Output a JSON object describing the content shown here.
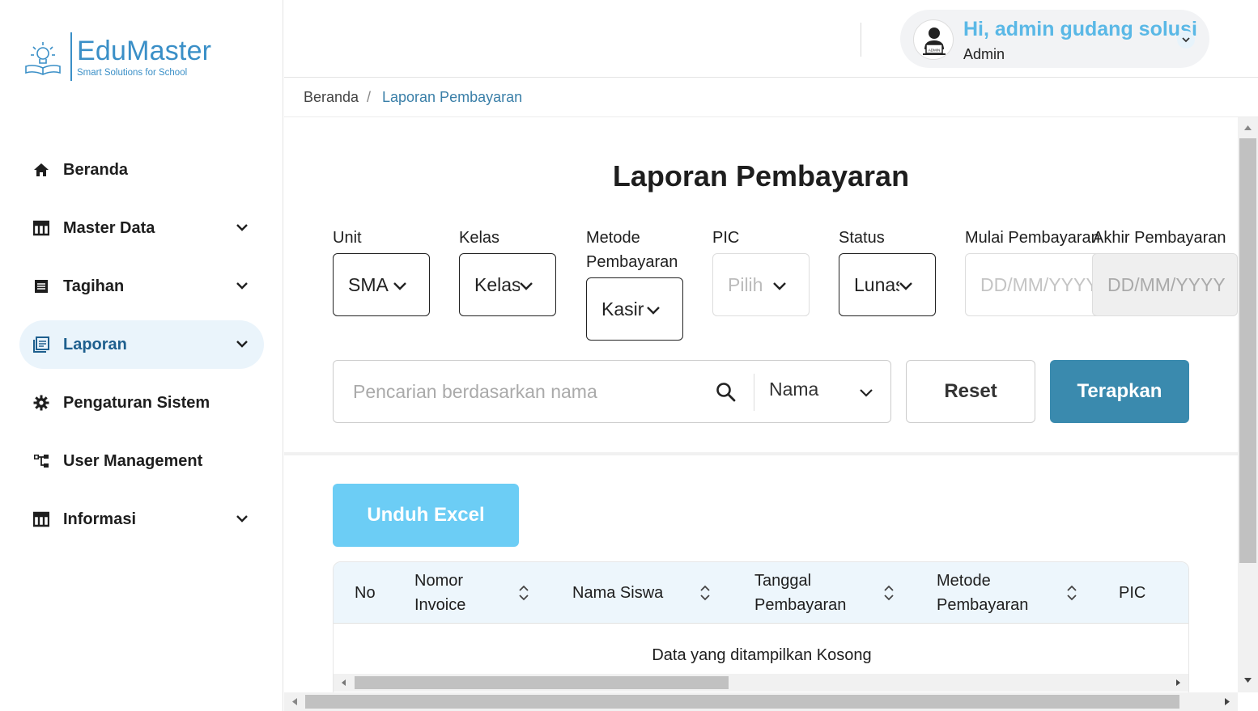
{
  "brand": {
    "name": "EduMaster",
    "tagline": "Smart Solutions for School",
    "color": "#3a8fc7"
  },
  "sidebar": {
    "items": [
      {
        "label": "Beranda",
        "icon": "home-icon",
        "has_submenu": false,
        "active": false
      },
      {
        "label": "Master Data",
        "icon": "table-icon",
        "has_submenu": true,
        "active": false
      },
      {
        "label": "Tagihan",
        "icon": "list-icon",
        "has_submenu": true,
        "active": false
      },
      {
        "label": "Laporan",
        "icon": "report-icon",
        "has_submenu": true,
        "active": true
      },
      {
        "label": "Pengaturan Sistem",
        "icon": "gear-icon",
        "has_submenu": false,
        "active": false
      },
      {
        "label": "User Management",
        "icon": "hierarchy-icon",
        "has_submenu": false,
        "active": false
      },
      {
        "label": "Informasi",
        "icon": "table-icon",
        "has_submenu": true,
        "active": false
      }
    ]
  },
  "header": {
    "greeting": "Hi, admin gudang solusi",
    "role": "Admin",
    "avatar_icon": "admin-avatar-icon"
  },
  "breadcrumb": {
    "home": "Beranda",
    "separator": "/",
    "current": "Laporan Pembayaran"
  },
  "page": {
    "title": "Laporan Pembayaran"
  },
  "filters": {
    "unit": {
      "label": "Unit",
      "value": "SMA"
    },
    "kelas": {
      "label": "Kelas",
      "value": "Kelas"
    },
    "metode": {
      "label": "Metode Pembayaran",
      "value": "Kasir"
    },
    "pic": {
      "label": "PIC",
      "value": "Pilih"
    },
    "status": {
      "label": "Status",
      "value": "Lunas"
    },
    "mulai": {
      "label": "Mulai Pembayaran",
      "placeholder": "DD/MM/YYYY"
    },
    "akhir": {
      "label": "Akhir Pembayaran",
      "placeholder": "DD/MM/YYYY"
    }
  },
  "search": {
    "placeholder": "Pencarian berdasarkan nama",
    "field": "Nama"
  },
  "buttons": {
    "reset": "Reset",
    "apply": "Terapkan",
    "export": "Unduh Excel"
  },
  "table": {
    "columns": [
      "No",
      "Nomor Invoice",
      "Nama Siswa",
      "Tanggal Pembayaran",
      "Metode Pembayaran",
      "PIC"
    ],
    "empty_message": "Data yang ditampilkan Kosong"
  },
  "colors": {
    "primary": "#3a8aae",
    "accent": "#6ccdf5",
    "greeting": "#5ab8e6",
    "active_bg": "#eaf4fb"
  }
}
